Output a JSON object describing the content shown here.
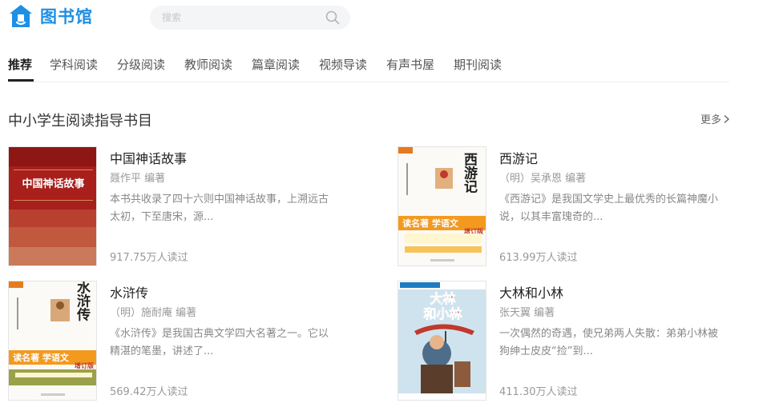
{
  "header": {
    "logo_text": "图书馆",
    "search_placeholder": "搜索"
  },
  "tabs": [
    {
      "label": "推荐",
      "active": true
    },
    {
      "label": "学科阅读"
    },
    {
      "label": "分级阅读"
    },
    {
      "label": "教师阅读"
    },
    {
      "label": "篇章阅读"
    },
    {
      "label": "视频导读"
    },
    {
      "label": "有声书屋"
    },
    {
      "label": "期刊阅读"
    }
  ],
  "section": {
    "title": "中小学生阅读指导书目",
    "more_label": "更多"
  },
  "books": [
    {
      "title": "中国神话故事",
      "author": "聂作平 编著",
      "desc": "本书共收录了四十六则中国神话故事，上溯远古太初，下至唐宋，源...",
      "reads": "917.75万人读过",
      "cover_text": "中国神话故事"
    },
    {
      "title": "西游记",
      "author": "（明）吴承恩 编著",
      "desc": "《西游记》是我国文学史上最优秀的长篇神魔小说，以其丰富瑰奇的...",
      "reads": "613.99万人读过",
      "cover_text": "西游记",
      "cover_banner": "读名著 学语文",
      "cover_badge": "增订版"
    },
    {
      "title": "水浒传",
      "author": "（明）施耐庵 编著",
      "desc": "《水浒传》是我国古典文学四大名著之一。它以精湛的笔墨，讲述了...",
      "reads": "569.42万人读过",
      "cover_text": "水浒传",
      "cover_banner": "读名著 学语文",
      "cover_badge": "增订版"
    },
    {
      "title": "大林和小林",
      "author": "张天翼 编著",
      "desc": "一次偶然的奇遇，使兄弟两人失散：弟弟小林被狗绅士皮皮“捡”到...",
      "reads": "411.30万人读过",
      "cover_text_1": "大林",
      "cover_text_2": "和小林"
    }
  ],
  "colors": {
    "brand": "#1e8fe4",
    "text_dark": "#222222",
    "text_muted": "#999999"
  }
}
